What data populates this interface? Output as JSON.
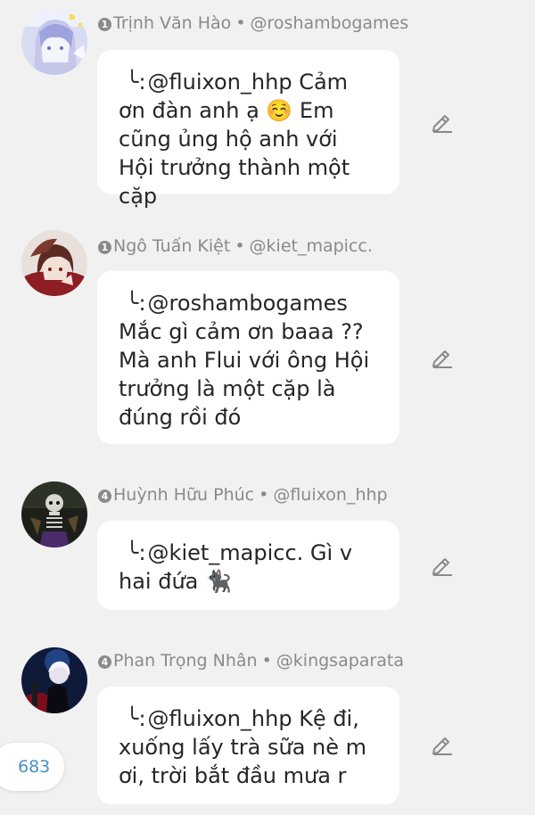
{
  "comments": [
    {
      "level": "1",
      "name": "Trịnh Văn Hào",
      "separator": "•",
      "handle": "@roshambogames",
      "reply_mark": "╰",
      "mention": "@fluixon_hhp Cảm ơn đàn anh ạ ☺️ Em cũng ủng hộ anh với Hội trưởng thành một cặp",
      "avatar_icon": "anime-avatar-white-hair"
    },
    {
      "level": "1",
      "name": "Ngô Tuấn Kiệt",
      "separator": "•",
      "handle": "@kiet_mapicc.",
      "reply_mark": "╰",
      "mention": "@roshambogames Mắc gì cảm ơn baaa ?? Mà anh Flui với ông Hội trưởng là một cặp là đúng rồi đó",
      "avatar_icon": "anime-avatar-red-hair"
    },
    {
      "level": "4",
      "name": "Huỳnh Hữu Phúc",
      "separator": "•",
      "handle": "@fluixon_hhp",
      "reply_mark": "╰",
      "mention": "@kiet_mapicc. Gì v hai đứa 🐈‍⬛",
      "avatar_icon": "anime-avatar-skeleton"
    },
    {
      "level": "4",
      "name": "Phan Trọng Nhân",
      "separator": "•",
      "handle": "@kingsaparata",
      "reply_mark": "╰",
      "mention": "@fluixon_hhp Kệ đi, xuống lấy trà sữa nè m ơi, trời bắt đầu mưa r",
      "avatar_icon": "anime-avatar-dark-scene"
    }
  ],
  "edit_icon": "pencil-icon",
  "counter": "683",
  "colors": {
    "background": "#f1f1f1",
    "bubble": "#ffffff",
    "meta_text": "#8a8a8a",
    "body_text": "#262626",
    "counter_text": "#4a90c8"
  }
}
